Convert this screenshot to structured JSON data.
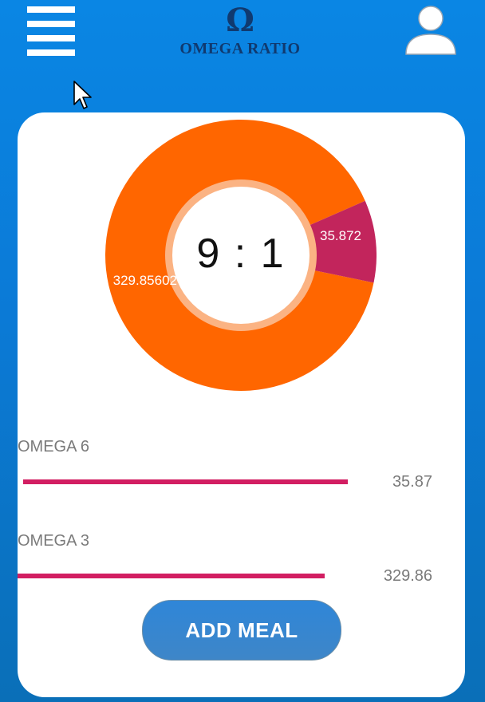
{
  "header": {
    "logo_symbol": "Ω",
    "logo_text": "OMEGA RATIO",
    "menu_icon": "hamburger-menu-icon",
    "profile_icon": "user-profile-icon"
  },
  "ratio": {
    "display": "9 : 1"
  },
  "chart_data": {
    "type": "pie",
    "title": "",
    "slices": [
      {
        "label": "329.85602",
        "value": 329.85602,
        "color": "#ff6600"
      },
      {
        "label": "35.872",
        "value": 35.872,
        "color": "#c2255c"
      }
    ]
  },
  "nutrients": [
    {
      "label": "OMEGA 6",
      "value": "35.87",
      "level": 0.74
    },
    {
      "label": "OMEGA 3",
      "value": "329.86",
      "level": 0.7
    }
  ],
  "actions": {
    "add_meal_label": "ADD MEAL"
  },
  "colors": {
    "background": "#0a86e4",
    "donut_orange": "#ff6600",
    "donut_magenta": "#c2255c",
    "bar": "#d21e62",
    "button": "#2f86d8",
    "logo": "#103a70"
  }
}
